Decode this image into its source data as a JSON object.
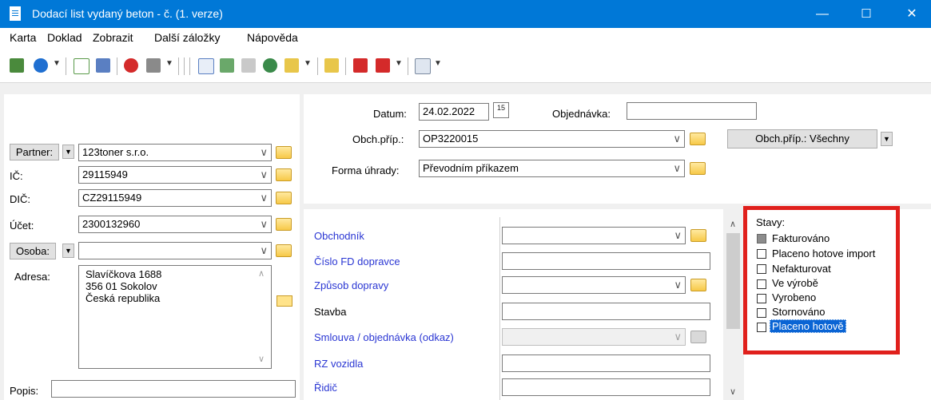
{
  "window": {
    "title": "Dodací list vydaný beton - č. (1. verze)",
    "minimize": "—",
    "maximize": "☐",
    "close": "✕"
  },
  "menu": [
    {
      "label": "Karta"
    },
    {
      "label": "Doklad"
    },
    {
      "label": "Zobrazit"
    },
    {
      "label": "Další záložky"
    },
    {
      "label": "Nápověda"
    }
  ],
  "partner": {
    "partner_label": "Partner:",
    "partner_value": "123toner s.r.o.",
    "ic_label": "IČ:",
    "ic_value": "29115949",
    "dic_label": "DIČ:",
    "dic_value": "CZ29115949",
    "ucet_label": "Účet:",
    "ucet_value": "2300132960",
    "osoba_label": "Osoba:",
    "osoba_value": "",
    "adresa_label": "Adresa:",
    "adresa_lines": [
      "Slavíčkova 1688",
      "356 01 Sokolov",
      "Česká republika"
    ],
    "popis_label": "Popis:",
    "popis_value": ""
  },
  "header": {
    "datum_label": "Datum:",
    "datum_value": "24.02.2022",
    "calendar_icon": "15",
    "objednavka_label": "Objednávka:",
    "objednavka_value": "",
    "obchprip_label": "Obch.příp.:",
    "obchprip_value": "OP3220015",
    "obchprip_filter_button": "Obch.příp.: Všechny",
    "forma_label": "Forma úhrady:",
    "forma_value": "Převodním příkazem"
  },
  "details": {
    "obchodnik": "Obchodník",
    "cislo_fd": "Číslo FD dopravce",
    "zpusob_dopravy": "Způsob dopravy",
    "stavba": "Stavba",
    "smlouva": "Smlouva / objednávka (odkaz)",
    "rz_vozidla": "RZ vozidla",
    "ridic": "Řidič"
  },
  "stavy": {
    "title": "Stavy:",
    "items": [
      {
        "label": "Fakturováno",
        "state": "indeterminate"
      },
      {
        "label": "Placeno hotove import",
        "state": "unchecked"
      },
      {
        "label": "Nefakturovat",
        "state": "unchecked"
      },
      {
        "label": "Ve výrobě",
        "state": "unchecked"
      },
      {
        "label": "Vyrobeno",
        "state": "unchecked"
      },
      {
        "label": "Stornováno",
        "state": "unchecked"
      },
      {
        "label": "Placeno hotově",
        "state": "unchecked",
        "selected": true
      }
    ],
    "highlight_color": "#e0201c"
  },
  "colors": {
    "titlebar": "#0078d7",
    "link": "#2a36d3",
    "selection": "#0a64d4"
  }
}
